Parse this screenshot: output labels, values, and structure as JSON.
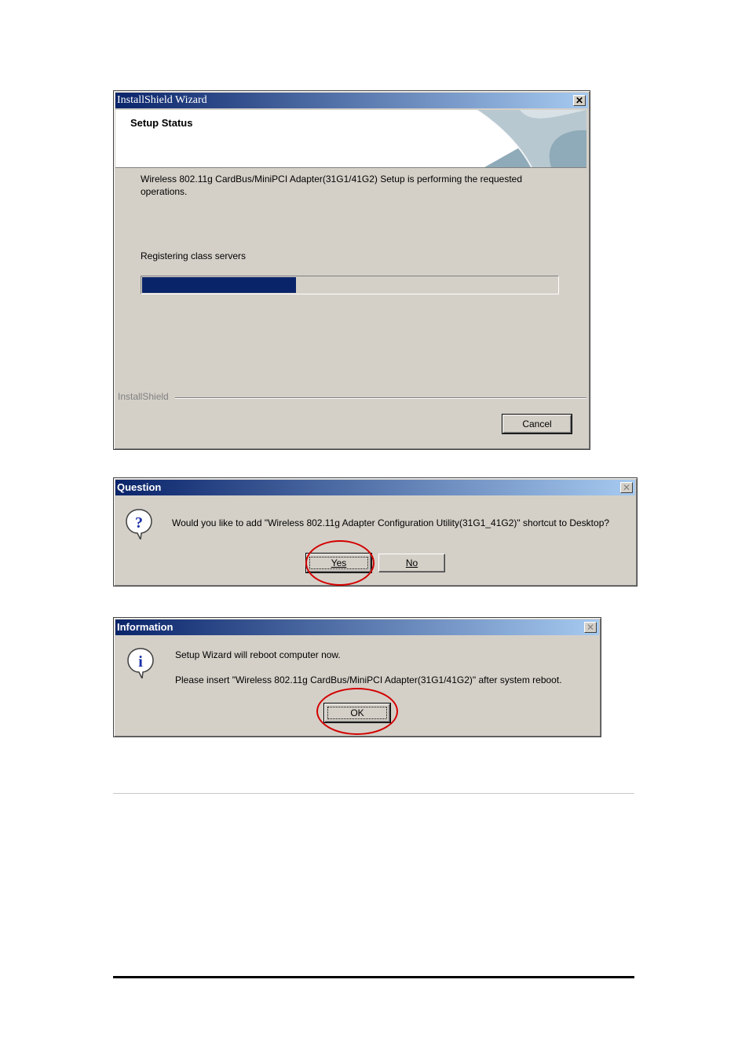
{
  "setup_dialog": {
    "title": "InstallShield Wizard",
    "header": "Setup Status",
    "message_line1": "Wireless 802.11g CardBus/MiniPCI Adapter(31G1/41G2) Setup is performing the requested",
    "message_line2": "operations.",
    "status": "Registering class servers",
    "progress_fraction": 0.37,
    "brand": "InstallShield",
    "cancel_label": "Cancel",
    "close_glyph": "✕"
  },
  "question_dialog": {
    "title": "Question",
    "message": "Would you like to add \"Wireless 802.11g Adapter Configuration Utility(31G1_41G2)\" shortcut to Desktop?",
    "yes_label": "Yes",
    "no_label": "No",
    "icon": "question-icon",
    "close_glyph": "✕"
  },
  "information_dialog": {
    "title": "Information",
    "message_line1": "Setup Wizard will reboot computer now.",
    "message_line2": "Please insert \"Wireless 802.11g CardBus/MiniPCI Adapter(31G1/41G2)\" after system reboot.",
    "ok_label": "OK",
    "icon": "information-icon",
    "close_glyph": "✕"
  },
  "colors": {
    "title_start": "#0a246a",
    "title_end": "#a6caf0",
    "progress": "#0a246a",
    "highlight_circle": "#d40000",
    "dialog_face": "#d4d0c8"
  }
}
